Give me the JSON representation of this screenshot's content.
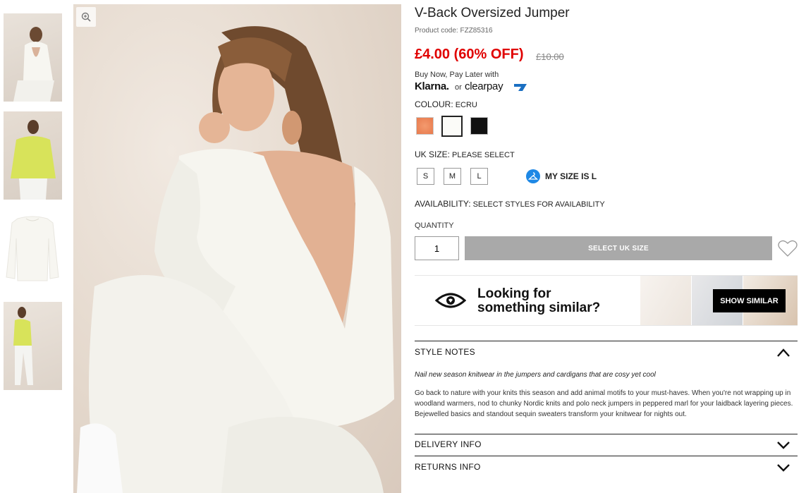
{
  "product": {
    "title": "V-Back Oversized Jumper",
    "code": "Product code: FZZ85316",
    "price": "£4.00 (60% OFF)",
    "was_price": "£10.00"
  },
  "payment": {
    "bnpl_text": "Buy Now, Pay Later with",
    "klarna": "Klarna.",
    "or": "or",
    "clearpay": "clearpay"
  },
  "colour": {
    "label": "COLOUR:",
    "selected": "ECRU",
    "swatches": [
      {
        "name": "coral",
        "color": "#ee8456"
      },
      {
        "name": "ecru",
        "color": "#fbfbf8"
      },
      {
        "name": "black",
        "color": "#111111"
      }
    ]
  },
  "size": {
    "label": "UK SIZE:",
    "selected": "PLEASE SELECT",
    "options": [
      "S",
      "M",
      "L"
    ],
    "my_size": "MY SIZE IS L"
  },
  "availability": {
    "label": "AVAILABILITY:",
    "value": "SELECT STYLES FOR AVAILABILITY"
  },
  "quantity": {
    "label": "QUANTITY",
    "value": "1"
  },
  "add_button": "SELECT UK SIZE",
  "similar": {
    "line1": "Looking for",
    "line2": "something similar?",
    "button": "SHOW SIMILAR"
  },
  "accordion": {
    "style_notes": {
      "title": "STYLE NOTES",
      "intro": "Nail new season knitwear in the jumpers and cardigans that are cosy yet cool",
      "body": "Go back to nature with your knits this season and add animal motifs to your must-haves. When you're not wrapping up in woodland warmers, nod to chunky Nordic knits and polo neck jumpers in peppered marl for your laidback layering pieces. Bejewelled basics and standout sequin sweaters transform your knitwear for nights out."
    },
    "delivery": {
      "title": "DELIVERY INFO"
    },
    "returns": {
      "title": "RETURNS INFO"
    }
  }
}
